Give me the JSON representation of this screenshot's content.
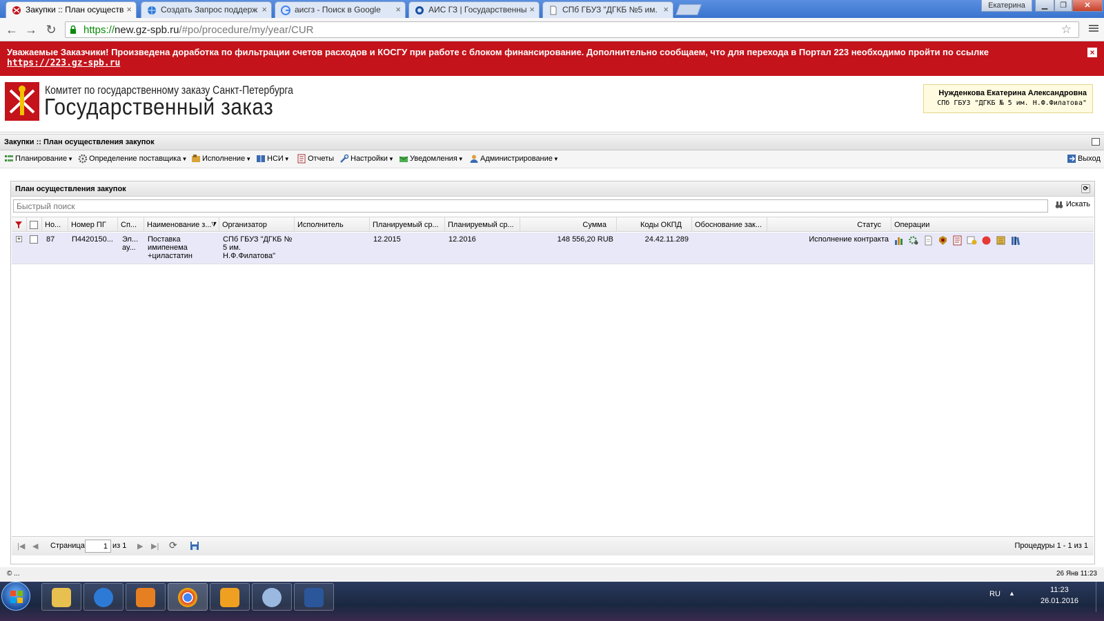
{
  "browser": {
    "tabs": [
      {
        "title": "Закупки :: План осуществ",
        "active": true
      },
      {
        "title": "Создать Запрос поддерж",
        "active": false
      },
      {
        "title": "аисгз - Поиск в Google",
        "active": false
      },
      {
        "title": "АИС ГЗ | Государственны",
        "active": false
      },
      {
        "title": "СПб ГБУЗ \"ДГКБ №5 им.",
        "active": false
      }
    ],
    "profile_name": "Екатерина",
    "url_scheme": "https://",
    "url_host": "new.gz-spb.ru",
    "url_path": "/#po/procedure/my/year/CUR"
  },
  "notice": {
    "text": "Уважаемые Заказчики! Произведена доработка по фильтрации счетов расходов и КОСГУ при работе с блоком финансирование. Дополнительно сообщаем, что для перехода в Портал 223 необходимо пройти по ссылке",
    "link": "https://223.gz-spb.ru",
    "close_icon": "×"
  },
  "header": {
    "org_name": "Комитет по государственному заказу Санкт-Петербурга",
    "site_name": "Государственный заказ",
    "user_name": "Нужденкова Екатерина Александровна",
    "user_org": "СПб ГБУЗ \"ДГКБ № 5 им. Н.Ф.Филатова\""
  },
  "breadcrumb": "Закупки :: План осуществления закупок",
  "menu": {
    "items": [
      {
        "label": "Планирование",
        "icon": "planning-icon",
        "dropdown": true
      },
      {
        "label": "Определение поставщика",
        "icon": "gears-icon",
        "dropdown": true
      },
      {
        "label": "Исполнение",
        "icon": "execution-icon",
        "dropdown": true
      },
      {
        "label": "НСИ",
        "icon": "book-icon",
        "dropdown": true
      },
      {
        "label": "Отчеты",
        "icon": "report-icon",
        "dropdown": false
      },
      {
        "label": "Настройки",
        "icon": "wrench-icon",
        "dropdown": true
      },
      {
        "label": "Уведомления",
        "icon": "notification-icon",
        "dropdown": true
      },
      {
        "label": "Администрирование",
        "icon": "admin-icon",
        "dropdown": true
      }
    ],
    "exit_label": "Выход"
  },
  "panel": {
    "title": "План осуществления закупок",
    "search_placeholder": "Быстрый поиск",
    "search_button": "Искать"
  },
  "grid": {
    "columns": [
      "Но...",
      "Номер ПГ",
      "Сп...",
      "Наименование з...",
      "Организатор",
      "Исполнитель",
      "Планируемый ср...",
      "Планируемый ср...",
      "Сумма",
      "Коды ОКПД",
      "Обоснование зак...",
      "Статус",
      "Операции"
    ],
    "rows": [
      {
        "no": "87",
        "number": "П4420150...",
        "method": "Эл...\nау...",
        "name": "Поставка\nимипенема\n+циластатин",
        "organizer": "СПб ГБУЗ \"ДГКБ №\n5 им.\nН.Ф.Филатова\"",
        "executor": "",
        "plan_start": "12.2015",
        "plan_end": "12.2016",
        "sum": "148 556,20 RUB",
        "okpd": "24.42.11.289",
        "justification": "",
        "status": "Исполнение контракта"
      }
    ]
  },
  "pager": {
    "page_label": "Страница",
    "page_value": "1",
    "of_label": "из 1",
    "summary": "Процедуры 1 - 1 из 1"
  },
  "footer": {
    "copyright": "© ...",
    "datetime": "26 Янв 11:23"
  },
  "taskbar": {
    "lang": "RU",
    "time": "11:23",
    "date": "26.01.2016"
  },
  "colors": {
    "notice_bg": "#c4131b",
    "row_selected": "#e8e8f8",
    "url_host": "#0a8a0a"
  }
}
